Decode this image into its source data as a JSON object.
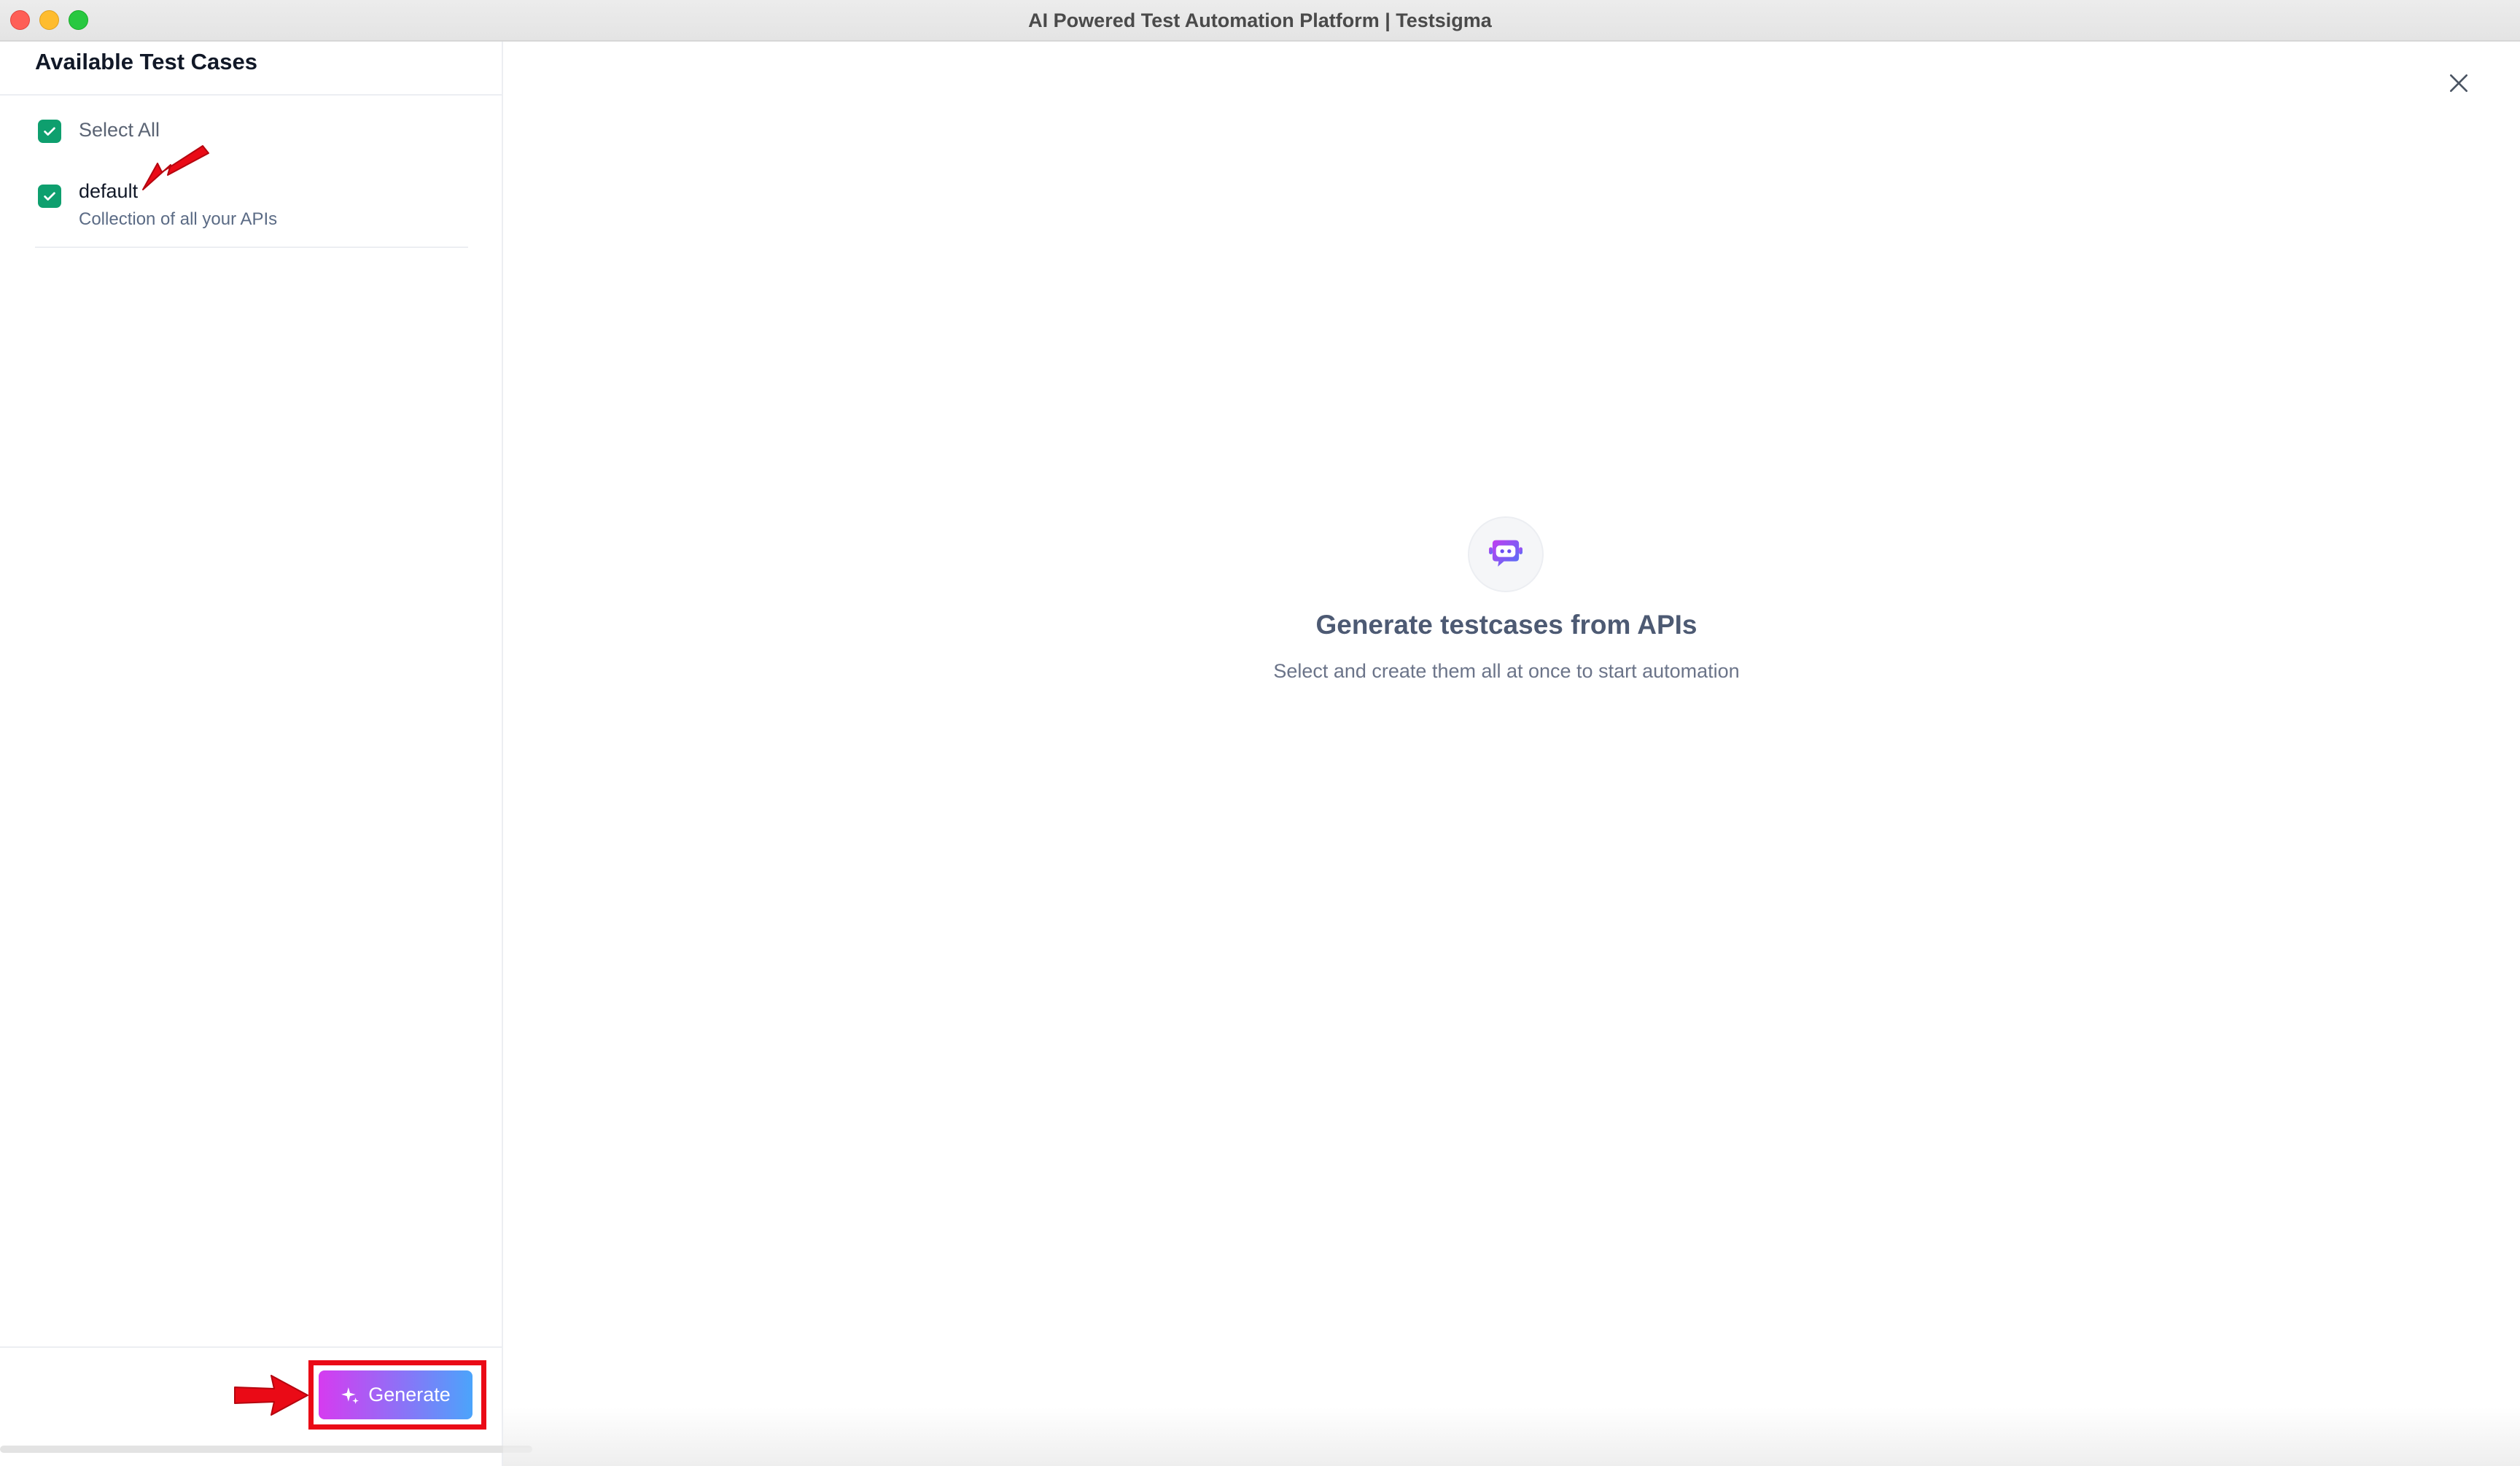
{
  "window": {
    "title": "AI Powered Test Automation Platform | Testsigma"
  },
  "left_panel": {
    "title": "Available Test Cases",
    "select_all": {
      "label": "Select All",
      "checked": true
    },
    "items": [
      {
        "name": "default",
        "description": "Collection of all your APIs",
        "checked": true
      }
    ],
    "generate_button": {
      "label": "Generate",
      "icon": "sparkle-icon"
    }
  },
  "main": {
    "close_icon": "close-icon",
    "empty_state": {
      "icon": "chatbot-icon",
      "title": "Generate testcases from APIs",
      "subtitle": "Select and create them all at once to start automation"
    }
  },
  "colors": {
    "checkbox": "#0e9f6e",
    "generate_gradient_start": "#d63bf0",
    "generate_gradient_end": "#4ba4fb",
    "annotation": "#ea0a16"
  }
}
